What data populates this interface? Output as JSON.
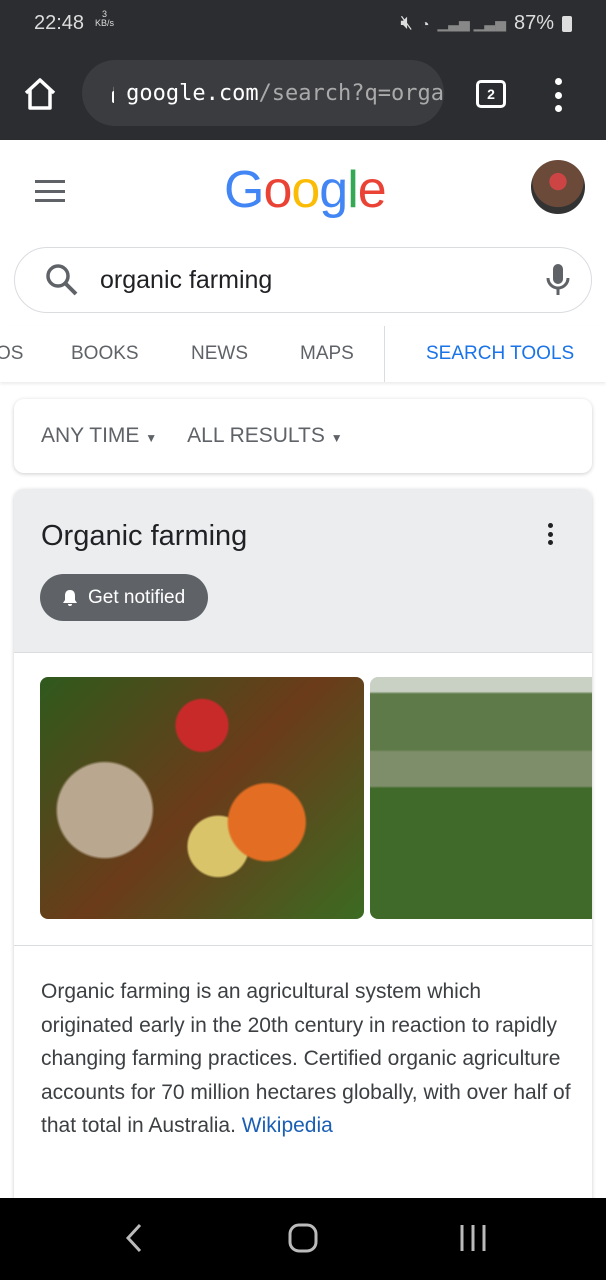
{
  "status": {
    "time": "22:48",
    "net_speed": "3",
    "net_unit": "KB/s",
    "battery": "87%"
  },
  "browser": {
    "url_host": "google.com",
    "url_path": "/search?q=orga",
    "tab_count": "2"
  },
  "header": {
    "logo": [
      "G",
      "o",
      "o",
      "g",
      "l",
      "e"
    ],
    "logo_colors": [
      "#4285f4",
      "#ea4335",
      "#fbbc05",
      "#4285f4",
      "#34a853",
      "#ea4335"
    ]
  },
  "search": {
    "query": "organic farming"
  },
  "nav": {
    "items": [
      "OS",
      "BOOKS",
      "NEWS",
      "MAPS"
    ],
    "search_tools": "SEARCH TOOLS"
  },
  "filters": {
    "time": "ANY TIME",
    "results": "ALL RESULTS"
  },
  "card": {
    "title": "Organic farming",
    "notify": "Get notified",
    "description": "Organic farming is an agricultural system which originated early in the 20th century in reaction to rapidly changing farming practices. Certified organic agriculture accounts for 70 million hectares globally, with over half of that total in Australia. ",
    "source": "Wikipedia"
  }
}
